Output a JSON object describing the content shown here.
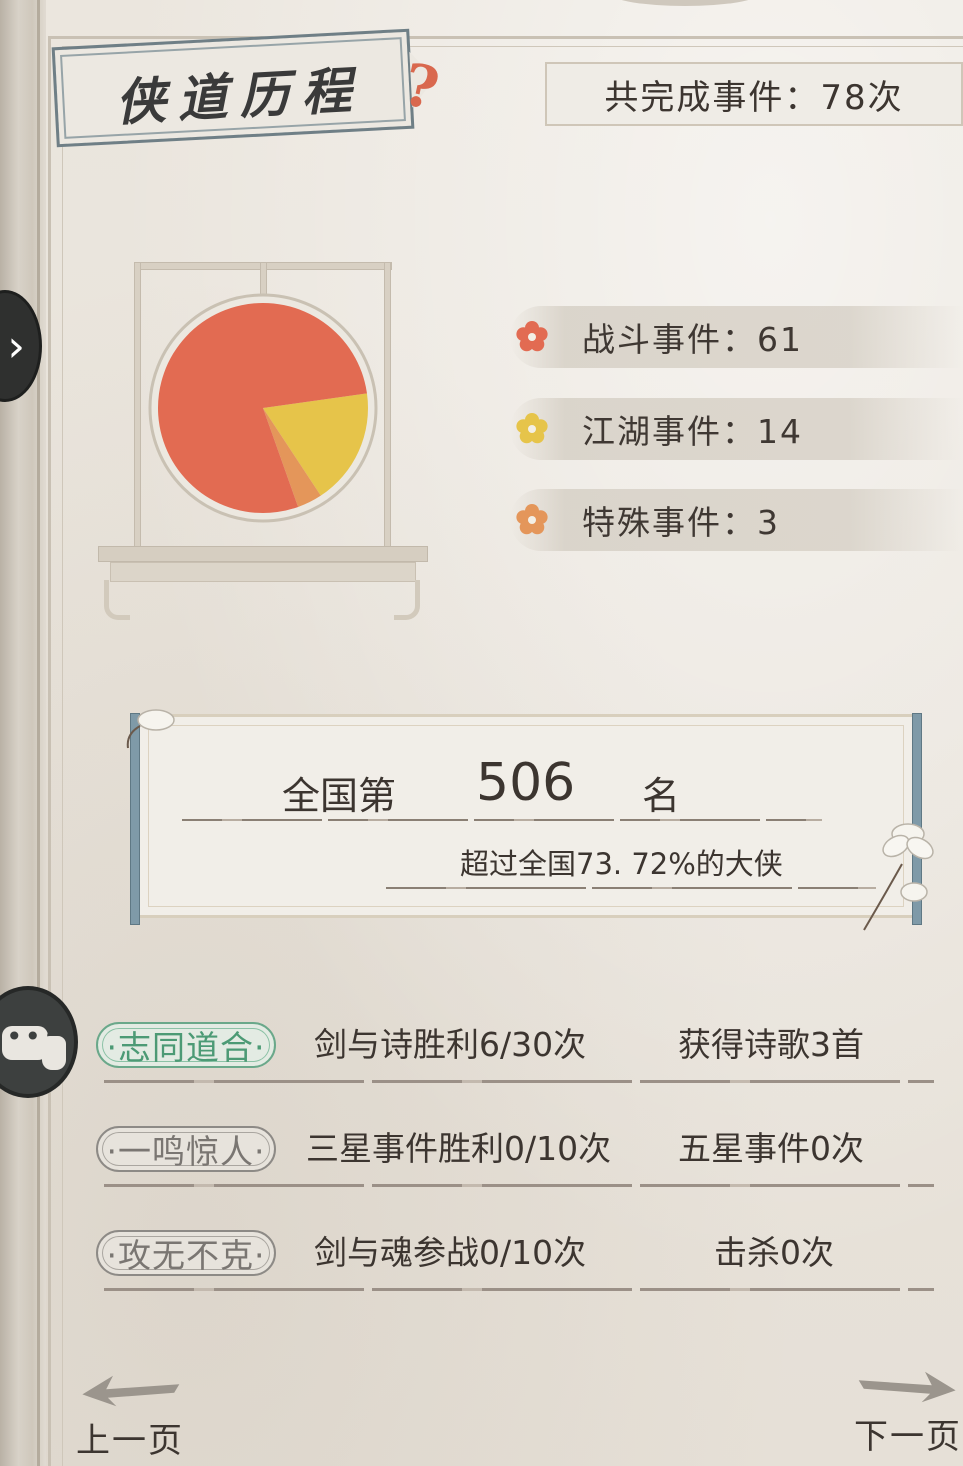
{
  "header": {
    "title": "侠道历程",
    "help_icon": "question-icon",
    "total_label": "共完成事件：78次"
  },
  "stats": {
    "total_events": 78,
    "categories": [
      {
        "label": "战斗事件：61",
        "name": "战斗事件",
        "value": 61,
        "color": "#e26b52",
        "icon": "flower-icon"
      },
      {
        "label": "江湖事件：14",
        "name": "江湖事件",
        "value": 14,
        "color": "#e6c44a",
        "icon": "flower-icon"
      },
      {
        "label": "特殊事件：3",
        "name": "特殊事件",
        "value": 3,
        "color": "#e4965a",
        "icon": "flower-icon"
      }
    ]
  },
  "chart_data": {
    "type": "pie",
    "categories": [
      "战斗事件",
      "江湖事件",
      "特殊事件"
    ],
    "values": [
      61,
      14,
      3
    ],
    "colors": [
      "#e26b52",
      "#e6c44a",
      "#e4965a"
    ],
    "title": ""
  },
  "rank": {
    "prefix": "全国第",
    "number": "506",
    "suffix": "名",
    "description": "超过全国73. 72%的大侠"
  },
  "achievements": [
    {
      "tag": "·志同道合·",
      "active": true,
      "condition": "剑与诗胜利6/30次",
      "reward": "获得诗歌3首"
    },
    {
      "tag": "·一鸣惊人·",
      "active": false,
      "condition": "三星事件胜利0/10次",
      "reward": "五星事件0次"
    },
    {
      "tag": "·攻无不克·",
      "active": false,
      "condition": "剑与魂参战0/10次",
      "reward": "击杀0次"
    }
  ],
  "nav": {
    "prev_label": "上一页",
    "next_label": "下一页"
  },
  "side": {
    "expand_icon": "chevron-right-icon",
    "chat_icon": "chat-icon"
  },
  "colors": {
    "accent_green": "#4c9a75",
    "background": "#e9e4dc",
    "scroll_rod": "#7f9aa8"
  }
}
